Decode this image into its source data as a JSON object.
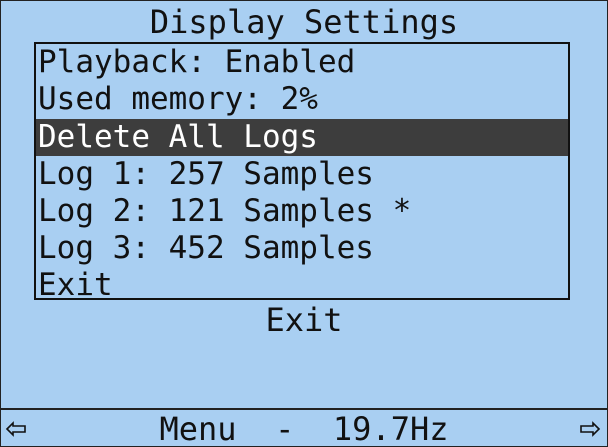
{
  "screen": {
    "title": "Display Settings",
    "menu": {
      "items": [
        {
          "label": "Playback: Enabled"
        },
        {
          "label": "Used memory: 2%"
        },
        {
          "label": "Delete All Logs"
        },
        {
          "label": "Log 1: 257 Samples"
        },
        {
          "label": "Log 2: 121 Samples *"
        },
        {
          "label": "Log 3: 452 Samples"
        },
        {
          "label": "Exit"
        }
      ],
      "selected_index": 2
    },
    "soft_key_label": "Exit",
    "status_bar": {
      "text": "Menu  -  19.7Hz",
      "left_icon": "left-arrow-icon",
      "right_icon": "right-arrow-icon"
    },
    "colors": {
      "background": "#a9cff2",
      "highlight": "#3d3d3d",
      "text": "#111111",
      "highlight_text": "#ffffff"
    }
  }
}
